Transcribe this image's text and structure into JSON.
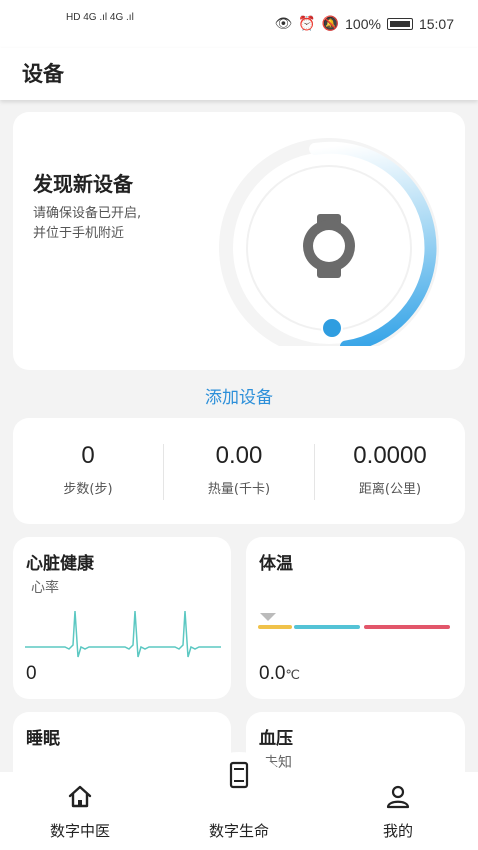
{
  "status_bar": {
    "left_text": "HD 4G .ıl 4G .ıl",
    "battery": "100%",
    "time": "15:07"
  },
  "header": {
    "title": "设备"
  },
  "discover": {
    "title": "发现新设备",
    "desc_line1": "请确保设备已开启,",
    "desc_line2": "并位于手机附近",
    "icon": "watch-icon"
  },
  "add_device_label": "添加设备",
  "stats": [
    {
      "value": "0",
      "label": "步数(步)"
    },
    {
      "value": "0.00",
      "label": "热量(千卡)"
    },
    {
      "value": "0.0000",
      "label": "距离(公里)"
    }
  ],
  "heart": {
    "title": "心脏健康",
    "subtitle": "心率",
    "value": "0"
  },
  "temperature": {
    "title": "体温",
    "value": "0.0",
    "unit": "℃"
  },
  "sleep": {
    "title": "睡眠"
  },
  "blood_pressure": {
    "title": "血压",
    "subtitle": "未知"
  },
  "nav": [
    {
      "label": "数字中医",
      "icon": "home-icon"
    },
    {
      "label": "数字生命",
      "icon": "tablet-icon"
    },
    {
      "label": "我的",
      "icon": "user-icon"
    }
  ],
  "colors": {
    "accent_blue": "#2c8fd9",
    "ring_blue": "#3aa6e8",
    "temp_yellow": "#f0c24a",
    "temp_cyan": "#54c3d6",
    "temp_red": "#e2566a",
    "ecg_line": "#5cc8c2"
  }
}
